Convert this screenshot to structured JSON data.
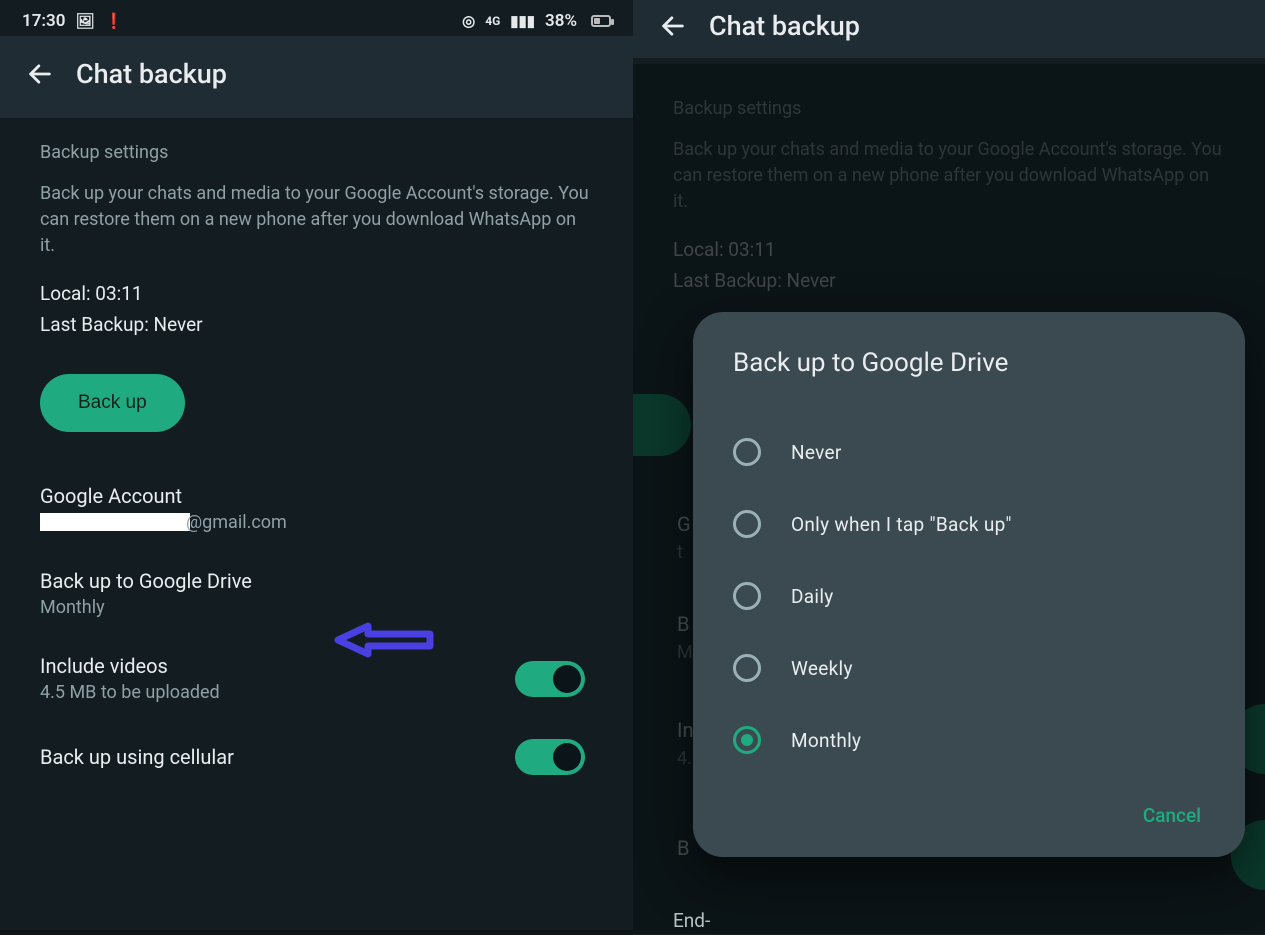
{
  "left": {
    "status": {
      "time": "17:30",
      "battery_text": "38%"
    },
    "appbar": {
      "title": "Chat backup"
    },
    "settings": {
      "heading": "Backup settings",
      "description": "Back up your chats and media to your Google Account's storage. You can restore them on a new phone after you download WhatsApp on it.",
      "local_line": "Local: 03:11",
      "lastbackup_line": "Last Backup: Never",
      "backup_btn": "Back up"
    },
    "account": {
      "label": "Google Account",
      "email_visible_suffix": "@gmail.com"
    },
    "gdrive": {
      "label": "Back up to Google Drive",
      "value": "Monthly"
    },
    "videos": {
      "label": "Include videos",
      "sub": "4.5 MB to be uploaded"
    },
    "cellular": {
      "label": "Back up using cellular"
    }
  },
  "right": {
    "appbar": {
      "title": "Chat backup"
    },
    "settings": {
      "heading": "Backup settings",
      "description": "Back up your chats and media to your Google Account's storage. You can restore them on a new phone after you download WhatsApp on it.",
      "local_line": "Local: 03:11",
      "lastbackup_line": "Last Backup: Never"
    },
    "bg_letters": {
      "g": "G",
      "t": "t",
      "b1": "B",
      "m": "M",
      "in": "In",
      "four": "4.",
      "b2": "B"
    },
    "cutoff": "End-",
    "dialog": {
      "title": "Back up to Google Drive",
      "options": [
        "Never",
        "Only when I tap \"Back up\"",
        "Daily",
        "Weekly",
        "Monthly"
      ],
      "selected_index": 4,
      "cancel": "Cancel"
    }
  }
}
